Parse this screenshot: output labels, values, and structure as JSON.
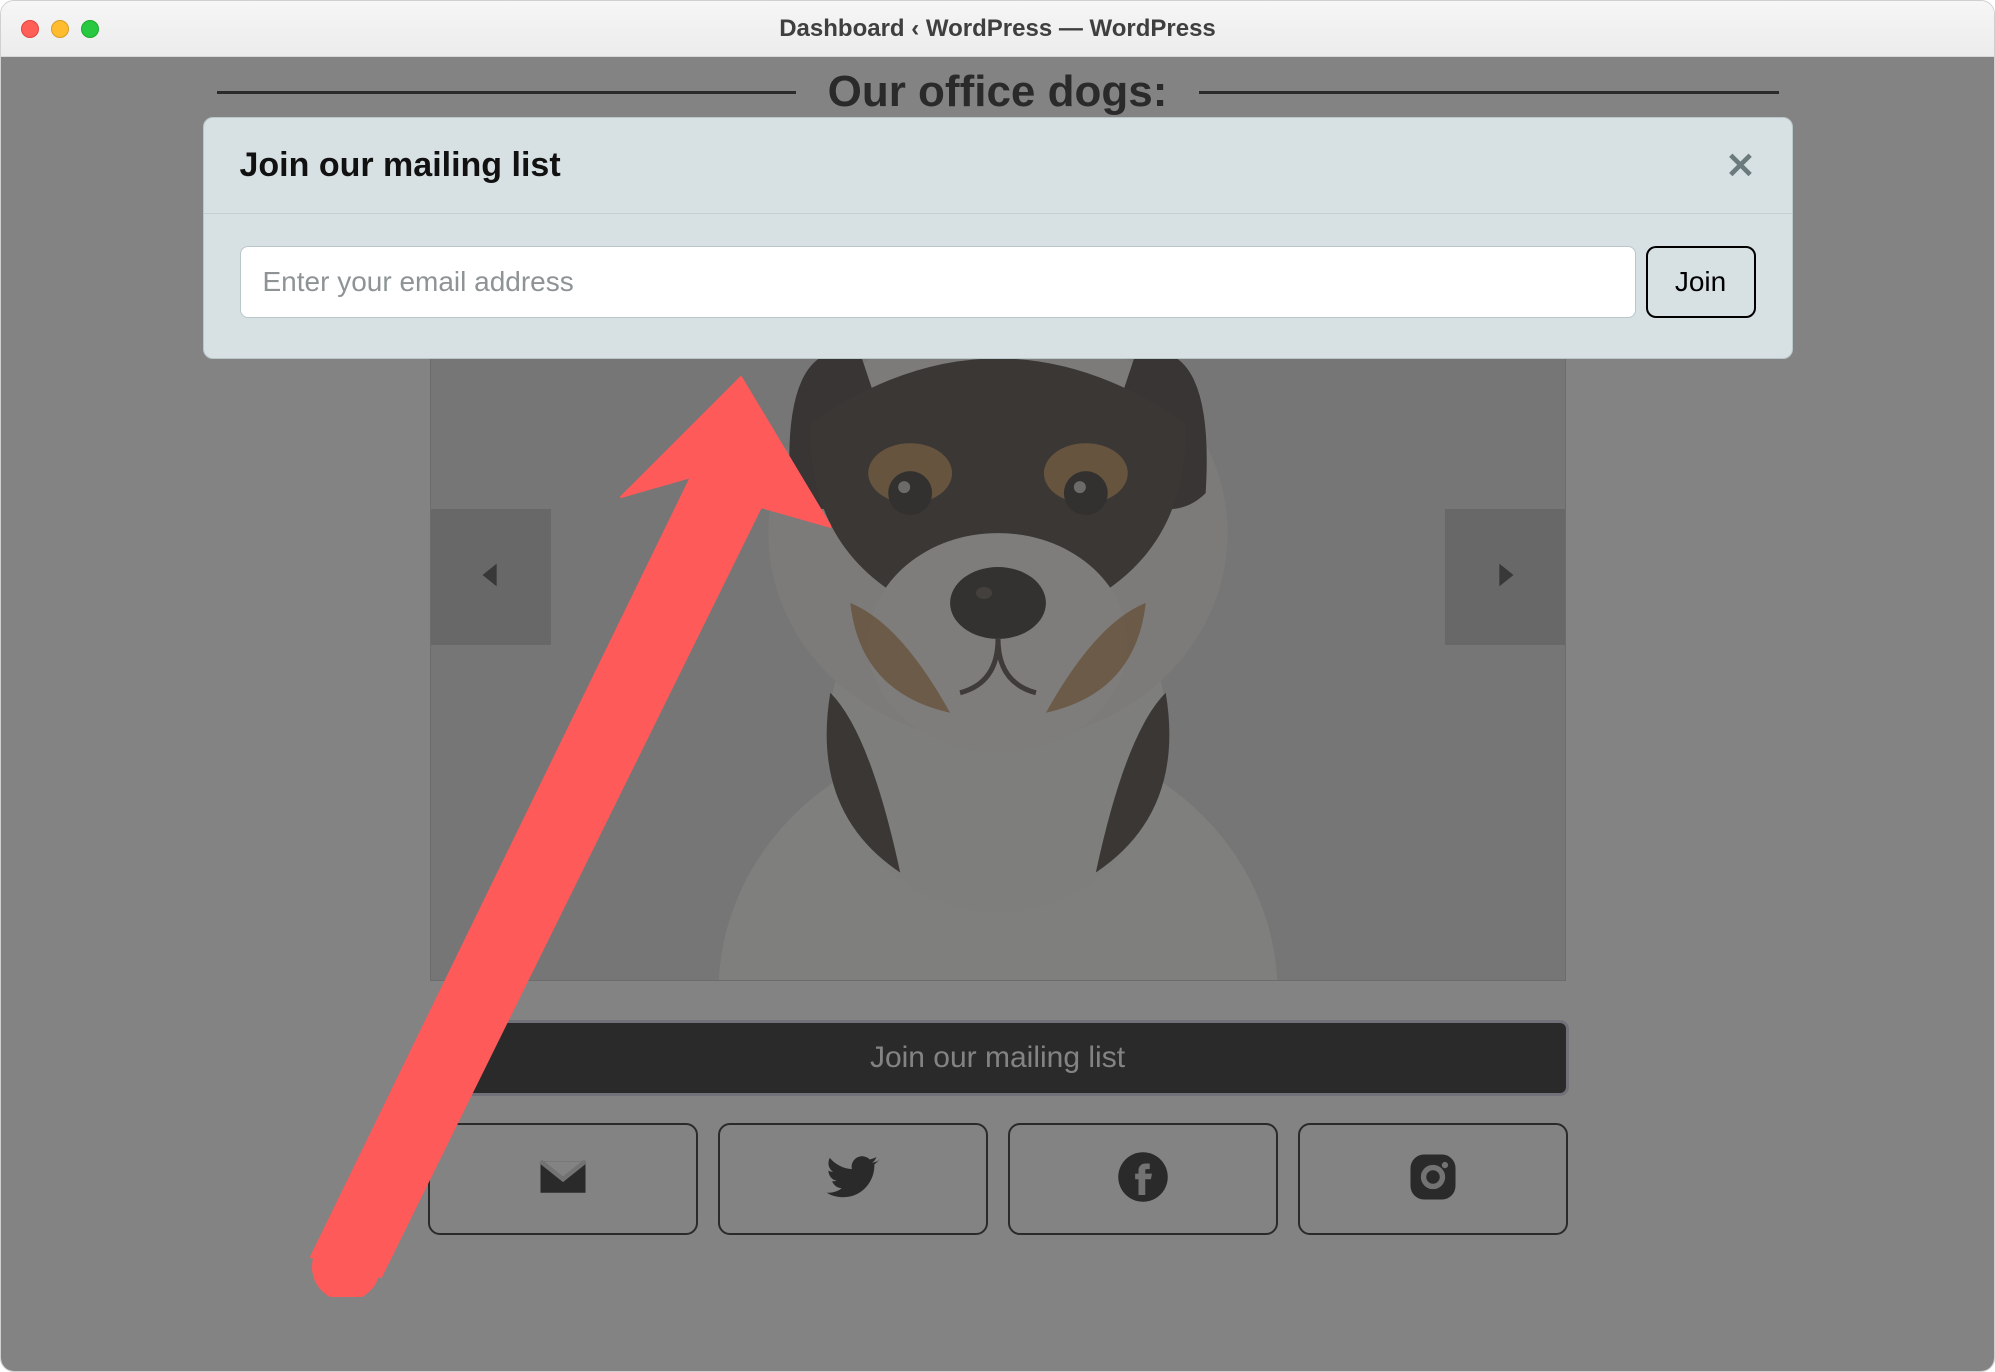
{
  "window": {
    "title": "Dashboard ‹ WordPress — WordPress"
  },
  "page": {
    "heading": "Our office dogs:",
    "join_bar_label": "Join our mailing list",
    "social": {
      "email": "email-icon",
      "twitter": "twitter-icon",
      "facebook": "facebook-icon",
      "instagram": "instagram-icon"
    }
  },
  "modal": {
    "title": "Join our mailing list",
    "email_placeholder": "Enter your email address",
    "join_label": "Join"
  }
}
